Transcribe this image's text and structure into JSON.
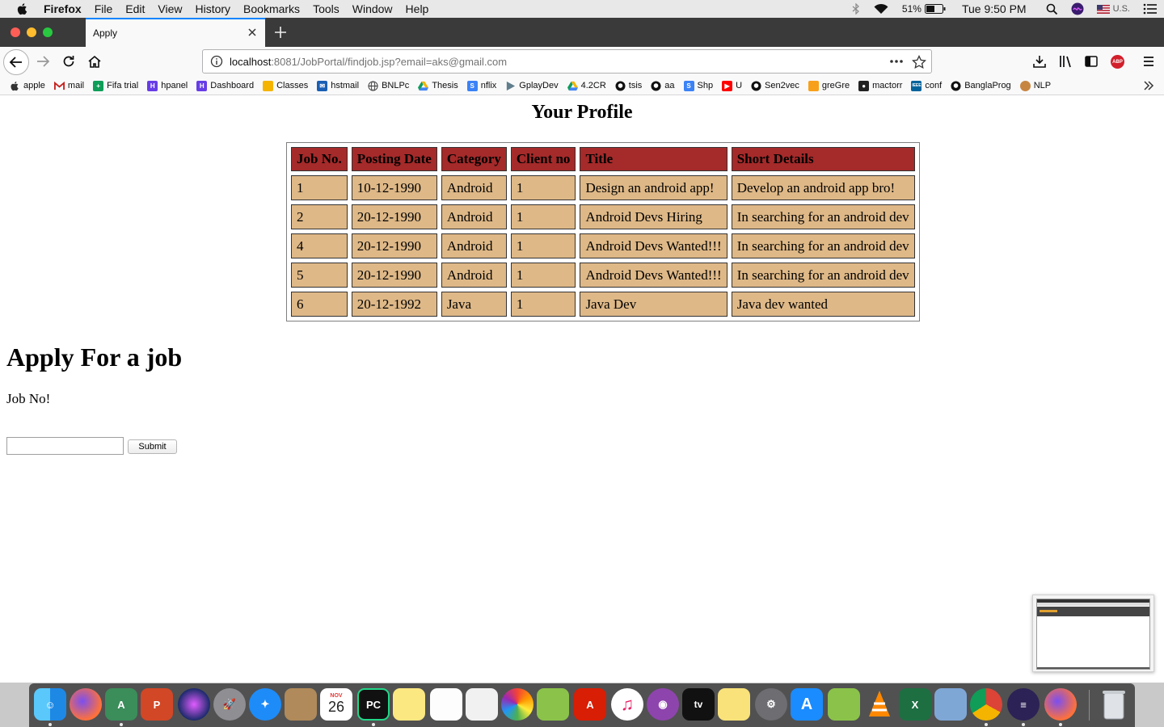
{
  "menubar": {
    "app_name": "Firefox",
    "menus": [
      "File",
      "Edit",
      "View",
      "History",
      "Bookmarks",
      "Tools",
      "Window",
      "Help"
    ],
    "battery": "51%",
    "clock": "Tue 9:50 PM",
    "input_source": "U.S."
  },
  "browser": {
    "tab_title": "Apply",
    "url_host": "localhost",
    "url_rest": ":8081/JobPortal/findjob.jsp?email=aks@gmail.com",
    "abp_label": "ABP",
    "bookmarks": [
      "apple",
      "mail",
      "Fifa trial",
      "hpanel",
      "Dashboard",
      "Classes",
      "hstmail",
      "BNLPc",
      "Thesis",
      "nflix",
      "GplayDev",
      "4.2CR",
      "tsis",
      "aa",
      "Shp",
      "U",
      "Sen2vec",
      "greGre",
      "mactorr",
      "conf",
      "BanglaProg",
      "NLP"
    ]
  },
  "page": {
    "profile_title": "Your Profile",
    "table": {
      "headers": [
        "Job No.",
        "Posting Date",
        "Category",
        "Client no",
        "Title",
        "Short Details"
      ],
      "rows": [
        [
          "1",
          "10-12-1990",
          "Android",
          "1",
          "Design an android app!",
          "Develop an android app bro!"
        ],
        [
          "2",
          "20-12-1990",
          "Android",
          "1",
          "Android Devs Hiring",
          "In searching for an android dev"
        ],
        [
          "4",
          "20-12-1990",
          "Android",
          "1",
          "Android Devs Wanted!!!",
          "In searching for an android dev"
        ],
        [
          "5",
          "20-12-1990",
          "Android",
          "1",
          "Android Devs Wanted!!!",
          "In searching for an android dev"
        ],
        [
          "6",
          "20-12-1992",
          "Java",
          "1",
          "Java Dev",
          "Java dev wanted"
        ]
      ]
    },
    "apply_heading": "Apply For a job",
    "job_no_label": "Job No!",
    "job_no_value": "",
    "submit_label": "Submit"
  },
  "dock": {
    "calendar_month": "NOV",
    "calendar_day": "26",
    "apps": [
      "finder",
      "firefox",
      "android-studio",
      "powerpoint",
      "siri",
      "launchpad",
      "safari",
      "contacts",
      "calendar",
      "pycharm",
      "notes",
      "reminders",
      "textedit",
      "photos",
      "maps",
      "acrobat",
      "itunes",
      "podcasts",
      "apple-tv",
      "stickies",
      "system-preferences",
      "app-store",
      "android",
      "vlc",
      "excel",
      "virtualbox",
      "chrome",
      "eclipse",
      "firefox",
      "trash"
    ]
  }
}
